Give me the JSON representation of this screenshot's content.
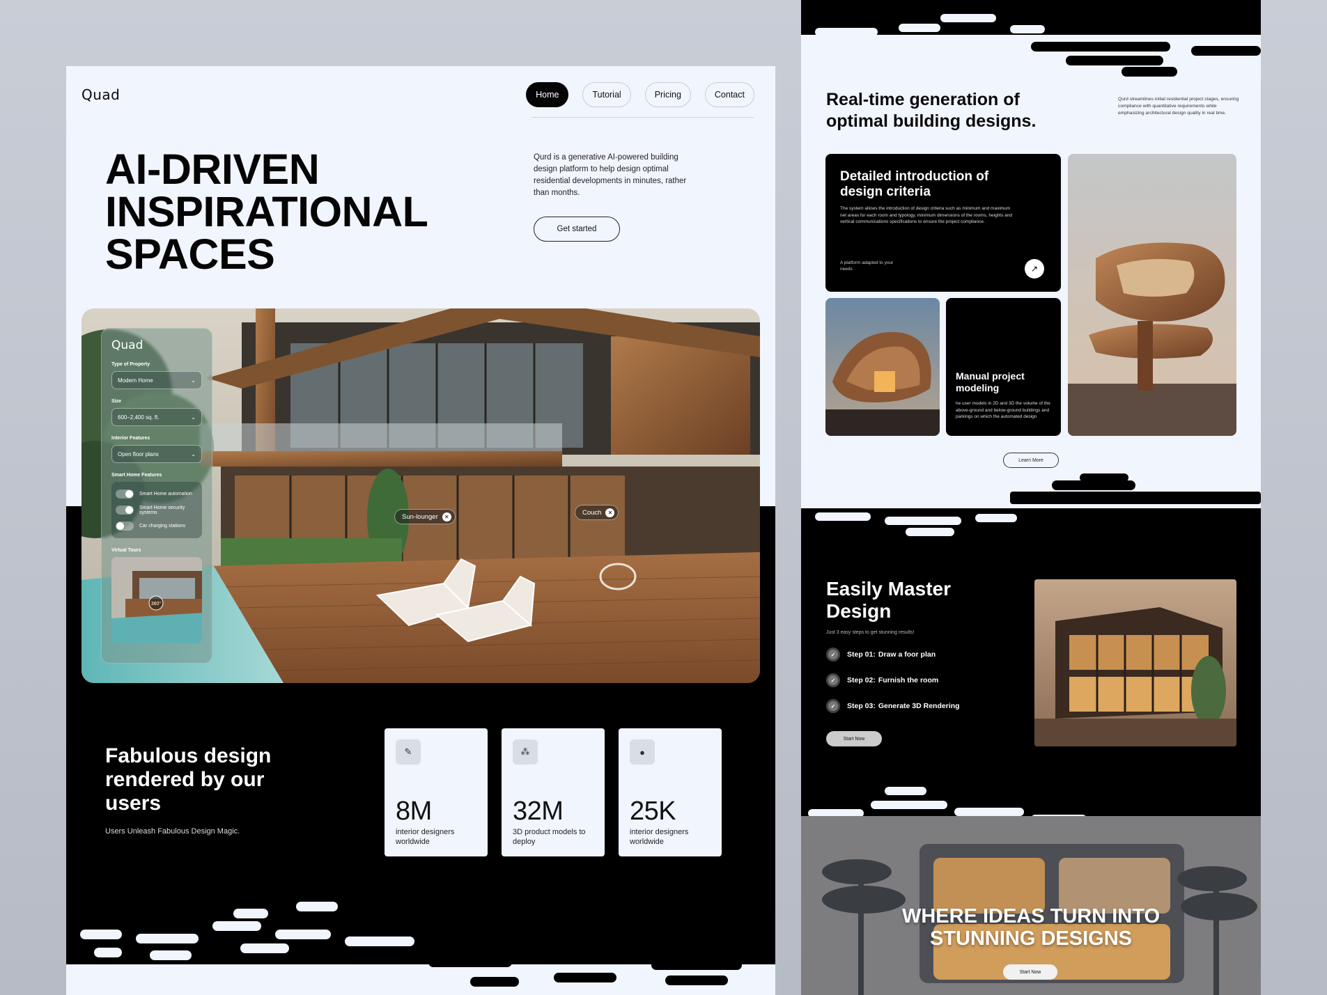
{
  "brand": "Quad",
  "nav": [
    "Home",
    "Tutorial",
    "Pricing",
    "Contact"
  ],
  "hero": {
    "title_lines": [
      "AI-DRIVEN",
      "INSPIRATIONAL",
      "SPACES"
    ],
    "description": "Qurd is a generative AI-powered building design platform to help design optimal residential developments in minutes, rather than months.",
    "cta": "Get started"
  },
  "panel": {
    "logo": "Quad",
    "type_label": "Type of Property",
    "type_value": "Modern Home",
    "size_label": "Size",
    "size_value": "600–2,400 sq. ft.",
    "interior_label": "Interior Features",
    "interior_value": "Open floor plans",
    "smart_label": "Smart Home Features",
    "smart_items": [
      "Smart Home automation",
      "Smart Home security systems",
      "Car charging stations"
    ],
    "virtual_label": "Virtual Tours",
    "badge": "360°"
  },
  "tags": [
    "Sun-lounger",
    "Couch"
  ],
  "fabulous": {
    "title": "Fabulous design rendered by our users",
    "subtitle": "Users Unleash Fabulous Design Magic."
  },
  "stats": [
    {
      "value": "8M",
      "caption": "interior designers worldwide",
      "icon": "pen-icon"
    },
    {
      "value": "32M",
      "caption": "3D product models to deploy",
      "icon": "network-icon"
    },
    {
      "value": "25K",
      "caption": "interior designers worldwide",
      "icon": "shapes-icon"
    }
  ],
  "realtime": {
    "title": "Real-time generation of optimal building designs.",
    "description": "Qurd streamlines initial residential project stages, ensuring compliance with quantitative requirements while emphasizing architectural design quality in real time."
  },
  "criteria": {
    "title": "Detailed introduction of design criteria",
    "body": "The system allows the introduction of design criteria such as minimum and maximum net areas for each room and typology, minimum dimensions of the rooms, heights and vertical communications specifications to ensure the project compliance.",
    "footer": "A platform adapted to your needs"
  },
  "manual": {
    "title": "Manual project modeling",
    "body": "he user models in 2D and 3D the volume of the above-ground and below-ground buildings and parkings on which the automated design"
  },
  "learn_more": "Learn More",
  "master": {
    "title": "Easily Master Design",
    "subtitle": "Just 3 easy steps to get stunning results!",
    "steps": [
      {
        "num": "Step 01:",
        "text": "Draw a foor plan"
      },
      {
        "num": "Step 02:",
        "text": "Furnish the room"
      },
      {
        "num": "Step 03:",
        "text": "Generate 3D Rendering"
      }
    ],
    "cta": "Start Now"
  },
  "ideas": {
    "title": "WHERE IDEAS TURN INTO STUNNING DESIGNS",
    "cta": "Start Now"
  }
}
